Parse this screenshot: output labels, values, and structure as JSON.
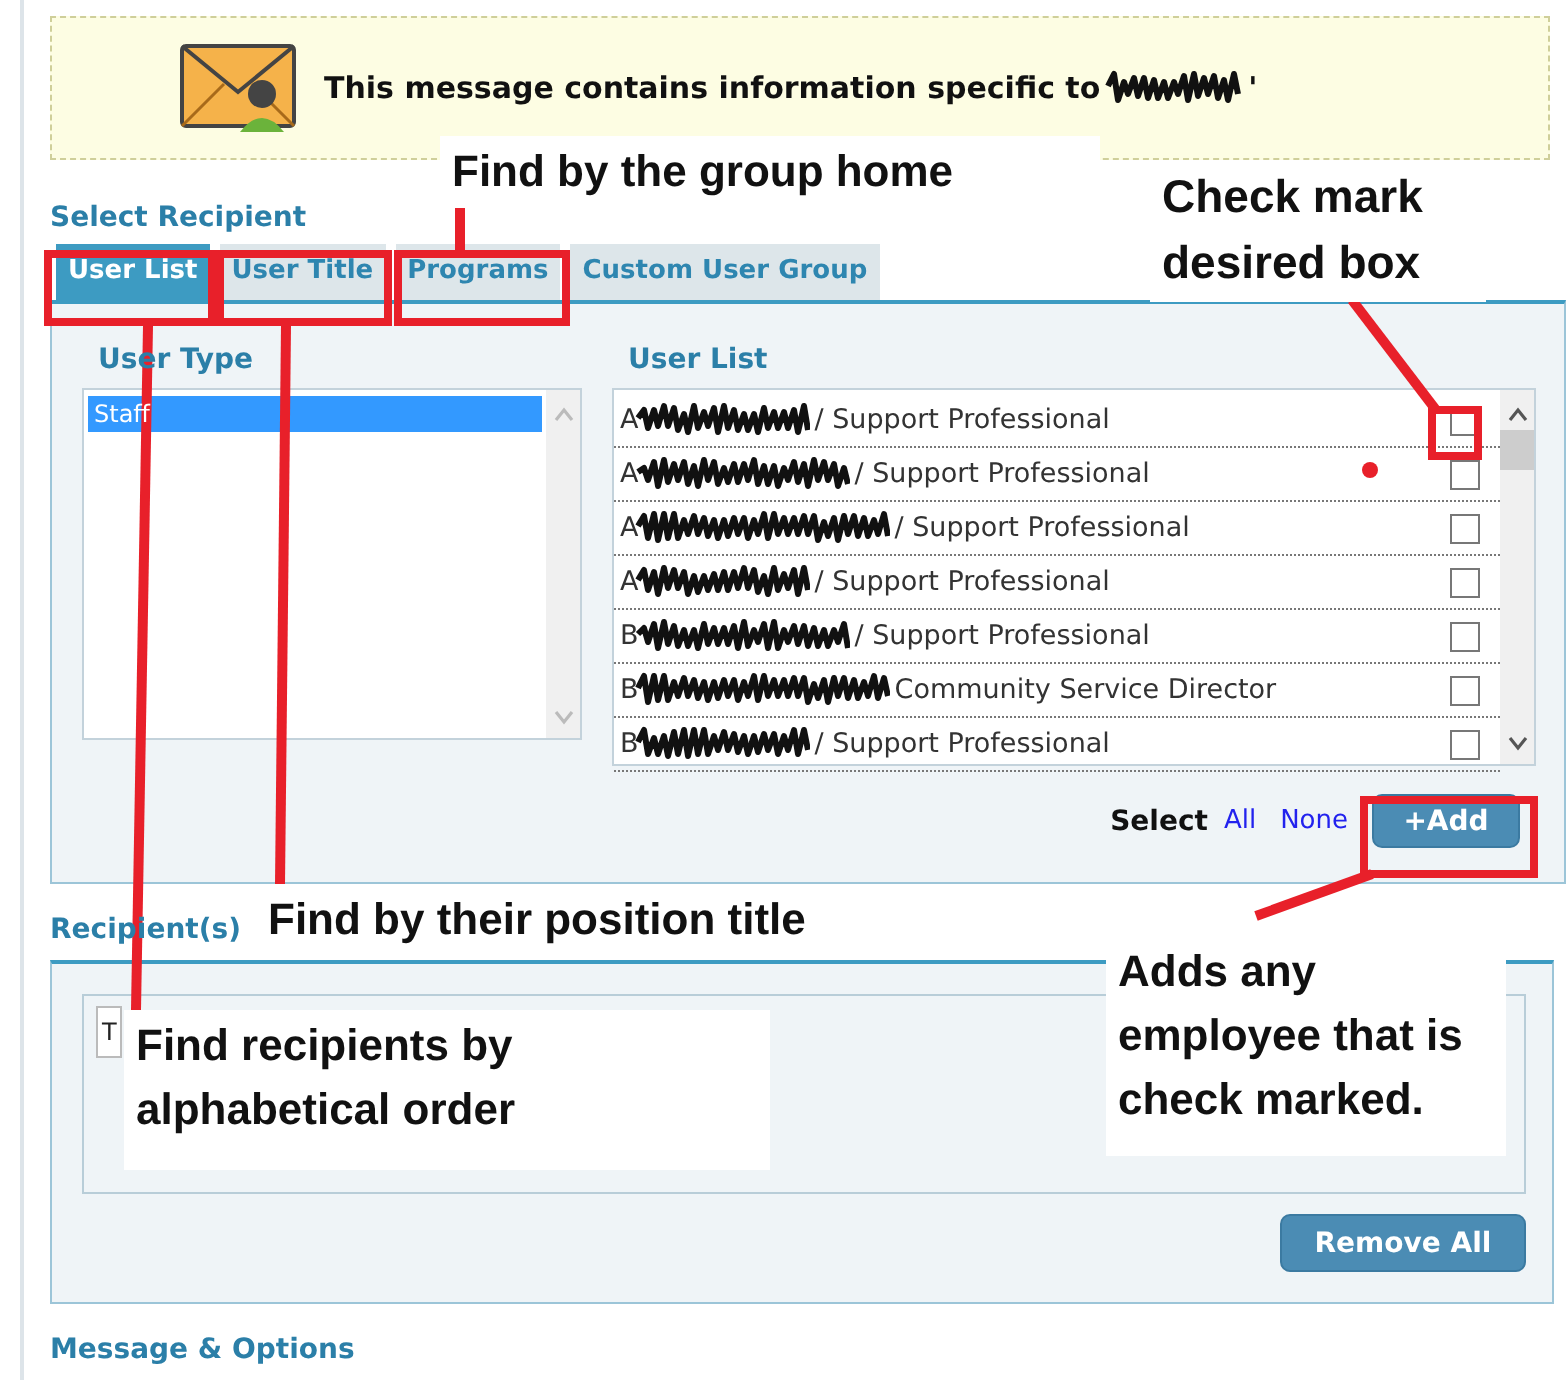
{
  "banner": {
    "message": "This message contains information specific to",
    "quote_mark": "'"
  },
  "select_recipient": {
    "heading": "Select Recipient",
    "tabs": [
      {
        "label": "User List",
        "selected": true
      },
      {
        "label": "User Title",
        "selected": false
      },
      {
        "label": "Programs",
        "selected": false
      },
      {
        "label": "Custom User Group",
        "selected": false
      }
    ],
    "user_type": {
      "heading": "User Type",
      "items": [
        {
          "label": "Staff",
          "selected": true
        }
      ]
    },
    "user_list": {
      "heading": "User List",
      "rows": [
        {
          "lead": "A",
          "title": "/ Support Professional",
          "checked": false
        },
        {
          "lead": "A",
          "title": "/ Support Professional",
          "checked": false
        },
        {
          "lead": "A",
          "title": "/ Support Professional",
          "checked": false
        },
        {
          "lead": "A",
          "title": "/ Support Professional",
          "checked": false
        },
        {
          "lead": "B",
          "title": "/ Support Professional",
          "checked": false
        },
        {
          "lead": "B",
          "title": "Community Service Director",
          "checked": false
        },
        {
          "lead": "B",
          "title": "/ Support Professional",
          "checked": false
        }
      ]
    },
    "select_label": "Select",
    "select_links": [
      "All",
      "None"
    ],
    "add_button": "+Add"
  },
  "recipients": {
    "heading": "Recipient(s)",
    "items": [
      "T"
    ],
    "remove_button": "Remove All"
  },
  "message_options": {
    "heading": "Message & Options"
  },
  "annotations": [
    {
      "text": "Find by the group home"
    },
    {
      "text": "Check mark desired box"
    },
    {
      "text": "Find by their position title"
    },
    {
      "text": "Find recipients by alphabetical order"
    },
    {
      "text": "Adds any employee that is check marked."
    }
  ]
}
